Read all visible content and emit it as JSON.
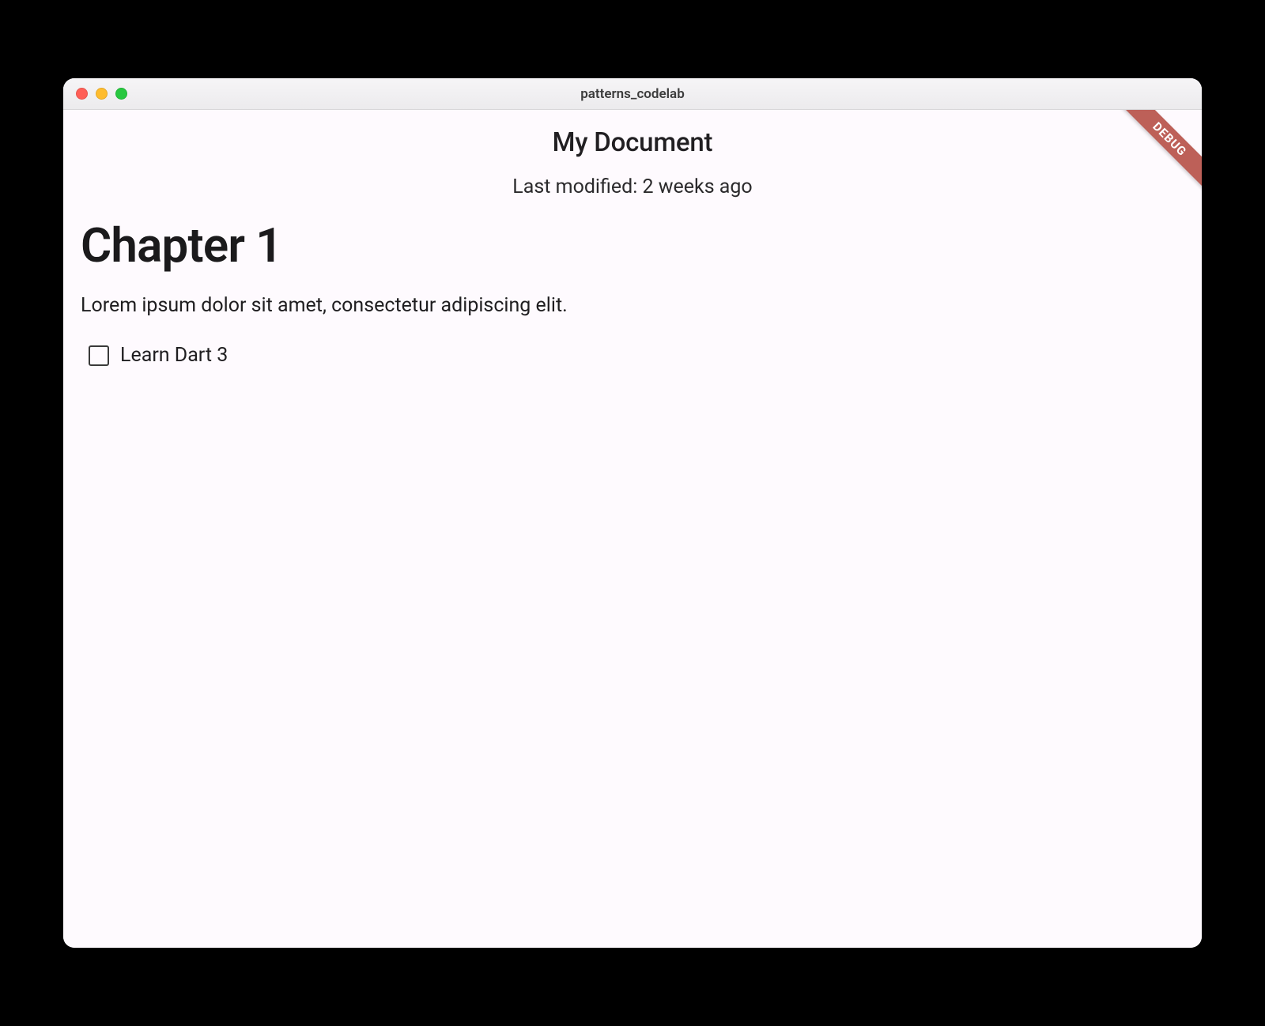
{
  "window": {
    "title": "patterns_codelab"
  },
  "header": {
    "title": "My Document",
    "subtitle": "Last modified: 2 weeks ago"
  },
  "content": {
    "heading": "Chapter 1",
    "paragraph": "Lorem ipsum dolor sit amet, consectetur adipiscing elit.",
    "checkbox": {
      "label": "Learn Dart 3",
      "checked": false
    }
  },
  "debug_banner": "DEBUG"
}
